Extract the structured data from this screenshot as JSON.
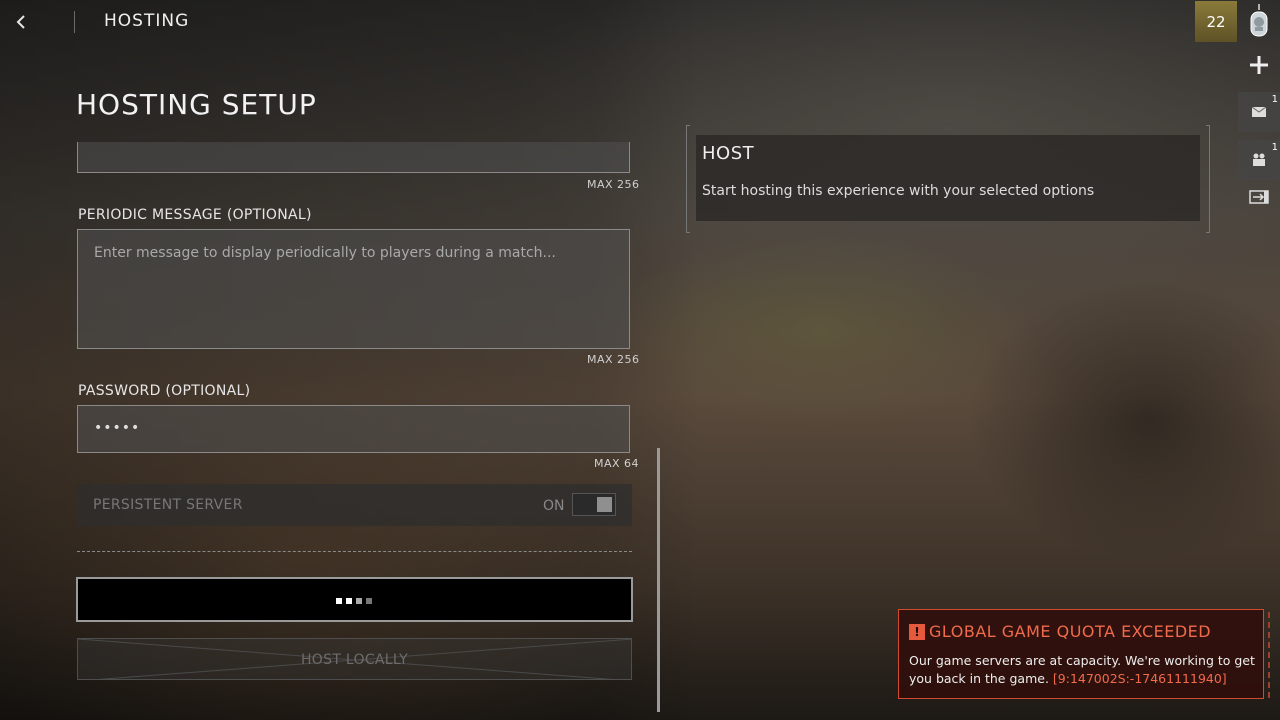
{
  "header": {
    "breadcrumb": "HOSTING",
    "player_level": "22"
  },
  "rail": {
    "messages_count": "1",
    "friends_count": "1"
  },
  "page": {
    "title": "HOSTING SETUP"
  },
  "form": {
    "top_field_max": "MAX 256",
    "periodic_message": {
      "label": "PERIODIC MESSAGE (OPTIONAL)",
      "placeholder": "Enter message to display periodically to players during a match...",
      "max": "MAX 256"
    },
    "password": {
      "label": "PASSWORD (OPTIONAL)",
      "value": "•••••",
      "max": "MAX 64"
    },
    "persistent_server": {
      "label": "PERSISTENT SERVER",
      "state": "ON"
    }
  },
  "actions": {
    "host_loading": true,
    "host_locally_label": "HOST LOCALLY"
  },
  "info_panel": {
    "title": "HOST",
    "description": "Start hosting this experience with your selected options"
  },
  "toast": {
    "title": "GLOBAL GAME QUOTA EXCEEDED",
    "message": "Our game servers are at capacity. We're working to get you back in the game.",
    "code": "[9:147002S:-17461111940]"
  },
  "colors": {
    "accent_error": "#f06a4c",
    "level_badge": "#7a6a30"
  }
}
